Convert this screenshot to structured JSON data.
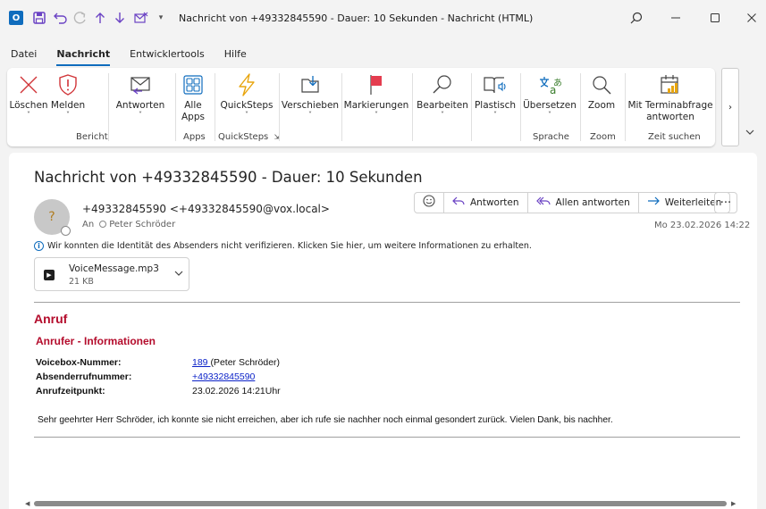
{
  "titlebar": {
    "title": "Nachricht von +49332845590 - Dauer: 10 Sekunden  -  Nachricht (HTML)",
    "logo": "O",
    "icons": [
      "outlook-logo-icon",
      "save-icon",
      "undo-icon",
      "redo-icon",
      "up-icon",
      "down-icon",
      "mail-icon",
      "customize-icon",
      "search-icon",
      "minimize-icon",
      "maximize-icon",
      "close-icon"
    ]
  },
  "menu": {
    "items": [
      "Datei",
      "Nachricht",
      "Entwicklertools",
      "Hilfe"
    ],
    "active": "Nachricht"
  },
  "ribbon": {
    "buttons": {
      "delete": "Löschen",
      "report": "Melden",
      "reply": "Antworten",
      "all_apps_1": "Alle",
      "all_apps_2": "Apps",
      "quicksteps": "QuickSteps",
      "move": "Verschieben",
      "tags": "Markierungen",
      "edit": "Bearbeiten",
      "immersive": "Plastisch",
      "translate": "Übersetzen",
      "zoom": "Zoom",
      "meeting_1": "Mit Terminabfrage",
      "meeting_2": "antworten"
    },
    "groups": {
      "report": "Bericht",
      "apps": "Apps",
      "quicksteps": "QuickSteps",
      "language": "Sprache",
      "zoom": "Zoom",
      "find_time": "Zeit suchen"
    },
    "chevron": "˅",
    "more": "›"
  },
  "message": {
    "subject": "Nachricht von +49332845590 - Dauer: 10 Sekunden",
    "avatar": "?",
    "sender": "+49332845590 <+49332845590@vox.local>",
    "to_label": "An",
    "to": "Peter Schröder",
    "date": "Mo 23.02.2026 14:22",
    "actions": {
      "reply": "Antworten",
      "reply_all": "Allen antworten",
      "forward": "Weiterleiten",
      "more": "···"
    },
    "info": "Wir konnten die Identität des Absenders nicht verifizieren. Klicken Sie hier, um weitere Informationen zu erhalten.",
    "attachment": {
      "name": "VoiceMessage.mp3",
      "size": "21 KB"
    }
  },
  "body": {
    "heading": "Anruf",
    "subheading": "Anrufer - Informationen",
    "fields": [
      {
        "label": "Voicebox-Nummer:",
        "value_link": "189 ",
        "value_text": "(Peter Schröder)"
      },
      {
        "label": "Absenderrufnummer:",
        "value_link": "+49332845590",
        "value_text": ""
      },
      {
        "label": "Anrufzeitpunkt:",
        "value_link": "",
        "value_text": "23.02.2026 14:21Uhr"
      }
    ],
    "message": "Sehr geehrter Herr Schröder, ich konnte sie nicht erreichen, aber ich rufe sie nachher noch einmal gesondert zurück. Vielen Dank, bis nachher."
  }
}
